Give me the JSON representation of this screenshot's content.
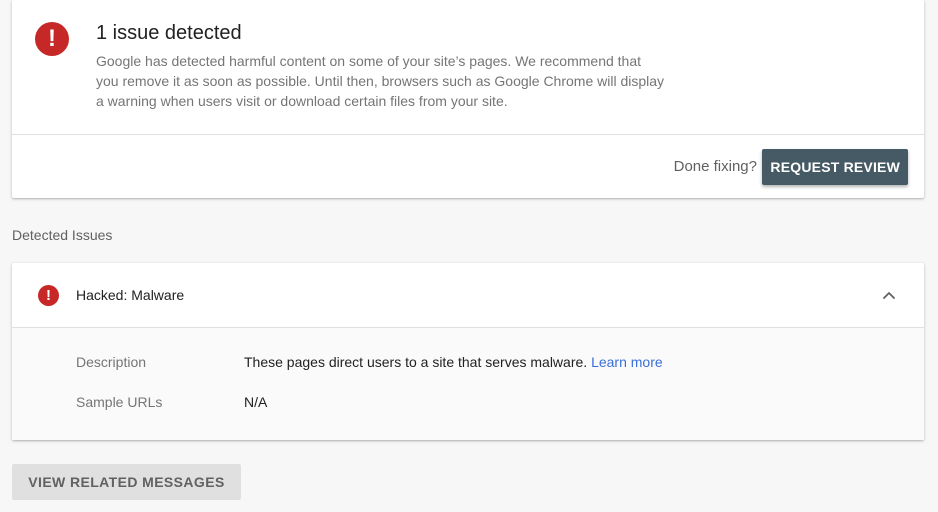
{
  "colors": {
    "alert_red": "#c62828",
    "primary_button": "#455a64",
    "link": "#3b6fd8"
  },
  "summary": {
    "icon": "alert-circle-icon",
    "icon_glyph": "!",
    "title": "1 issue detected",
    "body": "Google has detected harmful content on some of your site’s pages. We recommend that you remove it as soon as possible. Until then, browsers such as Google Chrome will display a warning when users visit or download certain files from your site.",
    "done_fixing_label": "Done fixing?",
    "request_review_label": "REQUEST REVIEW"
  },
  "detected_issues": {
    "heading": "Detected Issues",
    "issues": [
      {
        "icon": "alert-circle-icon",
        "icon_glyph": "!",
        "title": "Hacked: Malware",
        "expanded": true,
        "toggle_icon": "chevron-up-icon",
        "description_label": "Description",
        "description_value": "These pages direct users to a site that serves malware.",
        "learn_more_label": "Learn more",
        "sample_urls_label": "Sample URLs",
        "sample_urls_value": "N/A"
      }
    ]
  },
  "footer": {
    "view_related_messages_label": "VIEW RELATED MESSAGES"
  }
}
